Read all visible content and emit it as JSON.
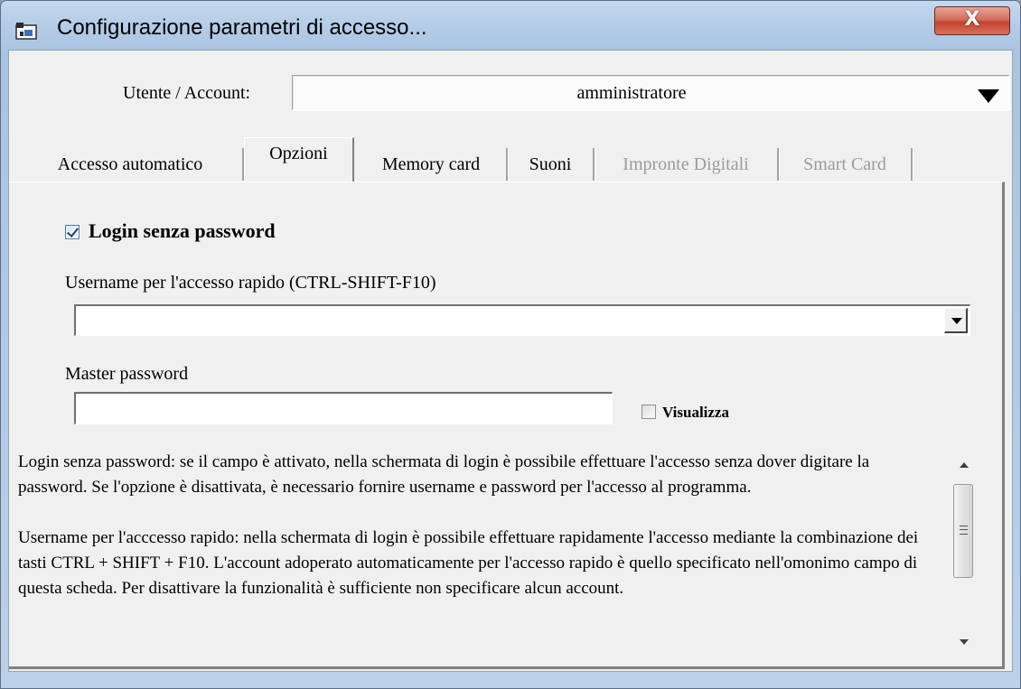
{
  "window": {
    "title": "Configurazione parametri di accesso...",
    "close_label": "X"
  },
  "user": {
    "label": "Utente / Account:",
    "value": "amministratore"
  },
  "tabs": [
    {
      "label": "Accesso automatico",
      "active": false,
      "enabled": true
    },
    {
      "label": "Opzioni",
      "active": true,
      "enabled": true
    },
    {
      "label": "Memory card",
      "active": false,
      "enabled": true
    },
    {
      "label": "Suoni",
      "active": false,
      "enabled": true
    },
    {
      "label": "Impronte Digitali",
      "active": false,
      "enabled": false
    },
    {
      "label": "Smart Card",
      "active": false,
      "enabled": false
    }
  ],
  "options": {
    "login_senza_password": {
      "label": "Login senza password",
      "checked": true
    },
    "username_rapido": {
      "label": "Username per l'accesso rapido (CTRL-SHIFT-F10)",
      "value": ""
    },
    "master_password": {
      "label": "Master password",
      "value": ""
    },
    "visualizza": {
      "label": "Visualizza",
      "checked": false
    }
  },
  "help": {
    "paragraph1": "Login senza password: se il campo è attivato, nella schermata di login è possibile effettuare l'accesso senza dover digitare la password. Se l'opzione è disattivata, è necessario fornire username e password per l'accesso al programma.",
    "paragraph2": "Username per l'acccesso rapido: nella schermata di login è possibile effettuare rapidamente l'accesso mediante la combinazione dei tasti CTRL + SHIFT + F10. L'account adoperato automaticamente per l'accesso rapido è quello specificato nell'omonimo campo di questa scheda. Per disattivare la funzionalità è sufficiente non specificare alcun account."
  },
  "colors": {
    "close_button": "#c94a35",
    "disabled_text": "#9b9b9b"
  }
}
